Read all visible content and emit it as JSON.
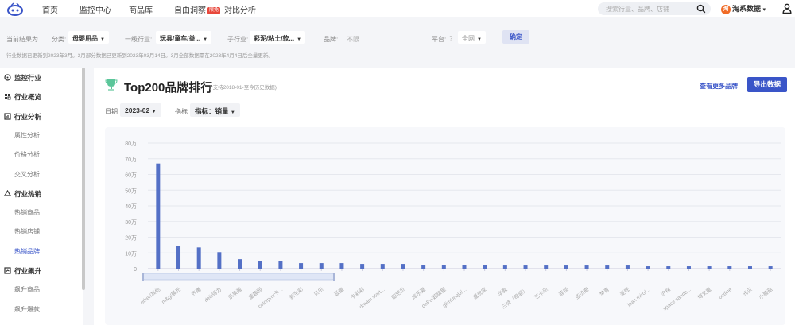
{
  "nav": {
    "items": [
      "首页",
      "监控中心",
      "商品库",
      "自由洞察",
      "对比分析"
    ],
    "new_badge": "限免",
    "search_placeholder": "搜索行业、品牌、店铺",
    "brand_initial": "淘",
    "brand_name": "淘系数据",
    "brand_arrow": "▾"
  },
  "filters": {
    "result_label": "当前结果为",
    "category_label": "分类:",
    "category_value": "母婴用品",
    "level1_label": "一级行业:",
    "level1_value": "玩具/童车/益...",
    "sub_label": "子行业:",
    "sub_value": "彩泥/粘土/软...",
    "brand_label": "品牌:",
    "brand_value": "不限",
    "platform_label": "平台:",
    "platform_value": "全网",
    "confirm": "确定",
    "note": "行业数据已更新到2023年3月。3月部分数据已更新到2023年03月14日。3月全部数据需在2023年4月4日后全量更新。"
  },
  "sidebar": {
    "items": [
      {
        "label": "监控行业",
        "type": "head",
        "icon": "monitor-icon"
      },
      {
        "label": "行业概览",
        "type": "head",
        "icon": "overview-icon"
      },
      {
        "label": "行业分析",
        "type": "head",
        "icon": "analysis-icon"
      },
      {
        "label": "属性分析",
        "type": "sub"
      },
      {
        "label": "价格分析",
        "type": "sub"
      },
      {
        "label": "交叉分析",
        "type": "sub"
      },
      {
        "label": "行业热销",
        "type": "head",
        "icon": "hot-icon"
      },
      {
        "label": "热销商品",
        "type": "sub"
      },
      {
        "label": "热销店铺",
        "type": "sub"
      },
      {
        "label": "热销品牌",
        "type": "sub",
        "active": true
      },
      {
        "label": "行业飙升",
        "type": "head",
        "icon": "rise-icon"
      },
      {
        "label": "飙升商品",
        "type": "sub"
      },
      {
        "label": "飙升爆款",
        "type": "sub"
      }
    ]
  },
  "main": {
    "title": "Top200品牌排行",
    "subtitle": "(*支持2018-01-至今历史数据)",
    "more_link": "查看更多品牌",
    "export": "导出数据",
    "date_label": "日期",
    "date_value": "2023-02",
    "metric_label": "指标",
    "metric_value": "指标：销量"
  },
  "colors": {
    "accent": "#3a55c8",
    "bar": "#5470c6"
  },
  "chart_data": {
    "type": "bar",
    "ylim": [
      0,
      80
    ],
    "yticks": [
      "0",
      "10万",
      "20万",
      "30万",
      "40万",
      "50万",
      "60万",
      "70万",
      "80万"
    ],
    "categories": [
      "other/其他",
      "m&g/晨光",
      "齐鹰",
      "deli/得力",
      "乐果酱",
      "童趣园",
      "colorpro/卡...",
      "新生彩",
      "贝乐",
      "延童",
      "卡彩彩",
      "dream start...",
      "图把贝",
      "库乐夏",
      "dePu/超级猩",
      "glimUnqU/...",
      "嘉优家",
      "华盈",
      "三特（母婴）",
      "艺卡乐",
      "菲视",
      "亚贝斯",
      "梦青",
      "麦旺",
      "joan miro/...",
      "沪铭",
      "space sandb...",
      "博文童",
      "octiine",
      "元贝",
      "小蘑菇"
    ],
    "values": [
      67,
      14.5,
      13.5,
      10.5,
      6,
      5,
      5,
      3.5,
      3.5,
      3.5,
      3,
      3,
      3,
      2.5,
      2.5,
      2.5,
      2.5,
      2,
      2,
      2,
      2,
      2,
      2,
      2,
      1.5,
      1.5,
      1.5,
      1.5,
      1.5,
      1.5,
      1.5
    ]
  }
}
